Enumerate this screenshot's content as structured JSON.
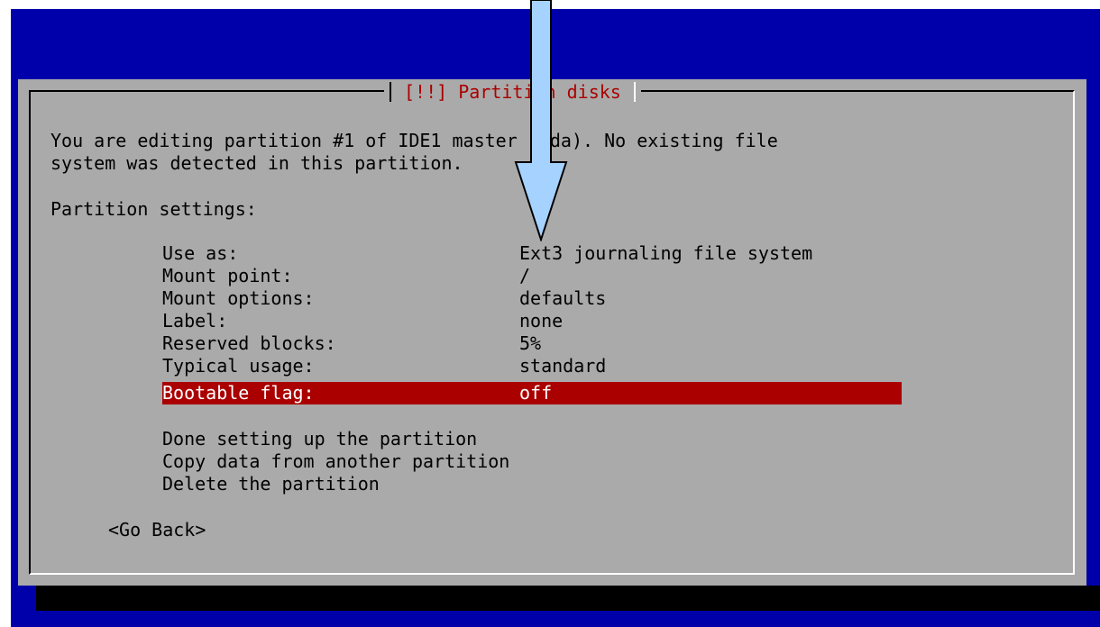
{
  "dialog": {
    "title": "[!!] Partition disks",
    "intro_line1": "You are editing partition #1 of IDE1 master (hda). No existing file",
    "intro_line2": "system was detected in this partition.",
    "section_heading": "Partition settings:"
  },
  "settings": [
    {
      "label": "Use as:",
      "value": "Ext3 journaling file system"
    },
    {
      "label": "Mount point:",
      "value": "/"
    },
    {
      "label": "Mount options:",
      "value": "defaults"
    },
    {
      "label": "Label:",
      "value": "none"
    },
    {
      "label": "Reserved blocks:",
      "value": "5%"
    },
    {
      "label": "Typical usage:",
      "value": "standard"
    },
    {
      "label": "Bootable flag:",
      "value": "off"
    }
  ],
  "actions": [
    "Done setting up the partition",
    "Copy data from another partition",
    "Delete the partition"
  ],
  "go_back": "<Go Back>",
  "colors": {
    "background": "#0000aa",
    "dialog": "#aaaaaa",
    "title": "#aa0000",
    "selection": "#aa0000",
    "arrow": "#a6d2ff"
  }
}
